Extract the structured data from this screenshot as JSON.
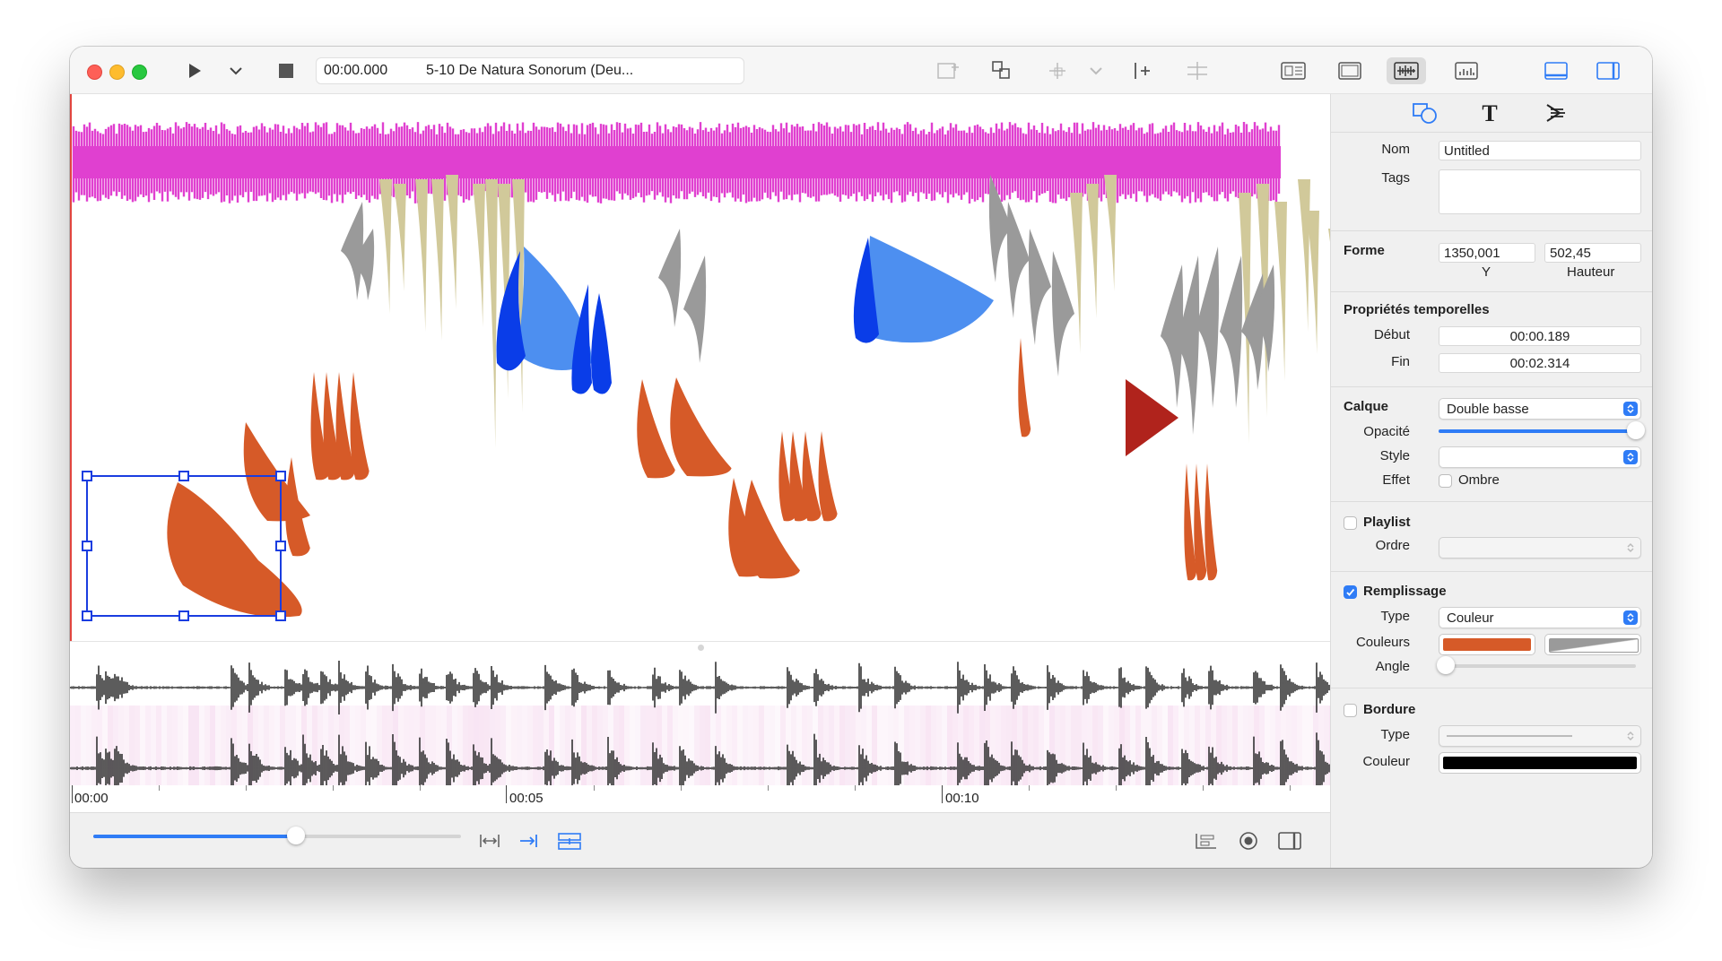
{
  "toolbar": {
    "time": "00:00.000",
    "document_title": "5-10 De Natura Sonorum (Deu...",
    "icons": [
      "play-icon",
      "chevron-down-icon",
      "stop-icon",
      "add-shape-icon",
      "group-icon",
      "add-point-icon",
      "add-marker-icon",
      "split-icon",
      "view-layout-icon",
      "single-view-icon",
      "waveform-view-icon",
      "spectrum-view-icon",
      "bottom-panel-icon",
      "right-panel-icon"
    ]
  },
  "canvas": {
    "colors": {
      "pink": "#e040d0",
      "khaki": "#d1c99a",
      "gray": "#9a9a9a",
      "blue": "#0a3de8",
      "lightblue": "#4d8ff0",
      "orange": "#d65a28",
      "red": "#b0231c",
      "selection": "#1a3de0"
    }
  },
  "timeline": {
    "labels": [
      "00:00",
      "00:05",
      "00:10"
    ]
  },
  "bottom": {
    "zoom_level": 0.55,
    "icons": [
      "fit-width-icon",
      "jump-to-end-icon",
      "tracks-icon",
      "align-icon",
      "record-icon",
      "sidebar-icon"
    ]
  },
  "inspector": {
    "tabs": [
      "shape-tab-icon",
      "text-tab-icon",
      "effects-tab-icon"
    ],
    "nom_label": "Nom",
    "nom_value": "Untitled",
    "tags_label": "Tags",
    "tags_value": "",
    "forme_label": "Forme",
    "y_value": "1350,001",
    "y_label": "Y",
    "hauteur_value": "502,45",
    "hauteur_label": "Hauteur",
    "temporal_header": "Propriétés temporelles",
    "debut_label": "Début",
    "debut_value": "00:00.189",
    "fin_label": "Fin",
    "fin_value": "00:02.314",
    "calque_label": "Calque",
    "calque_value": "Double basse",
    "opacite_label": "Opacité",
    "opacity_level": 1.0,
    "style_label": "Style",
    "style_value": "",
    "effet_label": "Effet",
    "ombre_label": "Ombre",
    "ombre_checked": false,
    "playlist_label": "Playlist",
    "playlist_checked": false,
    "ordre_label": "Ordre",
    "remplissage_label": "Remplissage",
    "remplissage_checked": true,
    "type_label": "Type",
    "fill_type_value": "Couleur",
    "couleurs_label": "Couleurs",
    "fill_color": "#d65a28",
    "angle_label": "Angle",
    "angle_level": 0.0,
    "bordure_label": "Bordure",
    "bordure_checked": false,
    "border_type_label": "Type",
    "couleur_label": "Couleur",
    "border_color": "#000000"
  }
}
